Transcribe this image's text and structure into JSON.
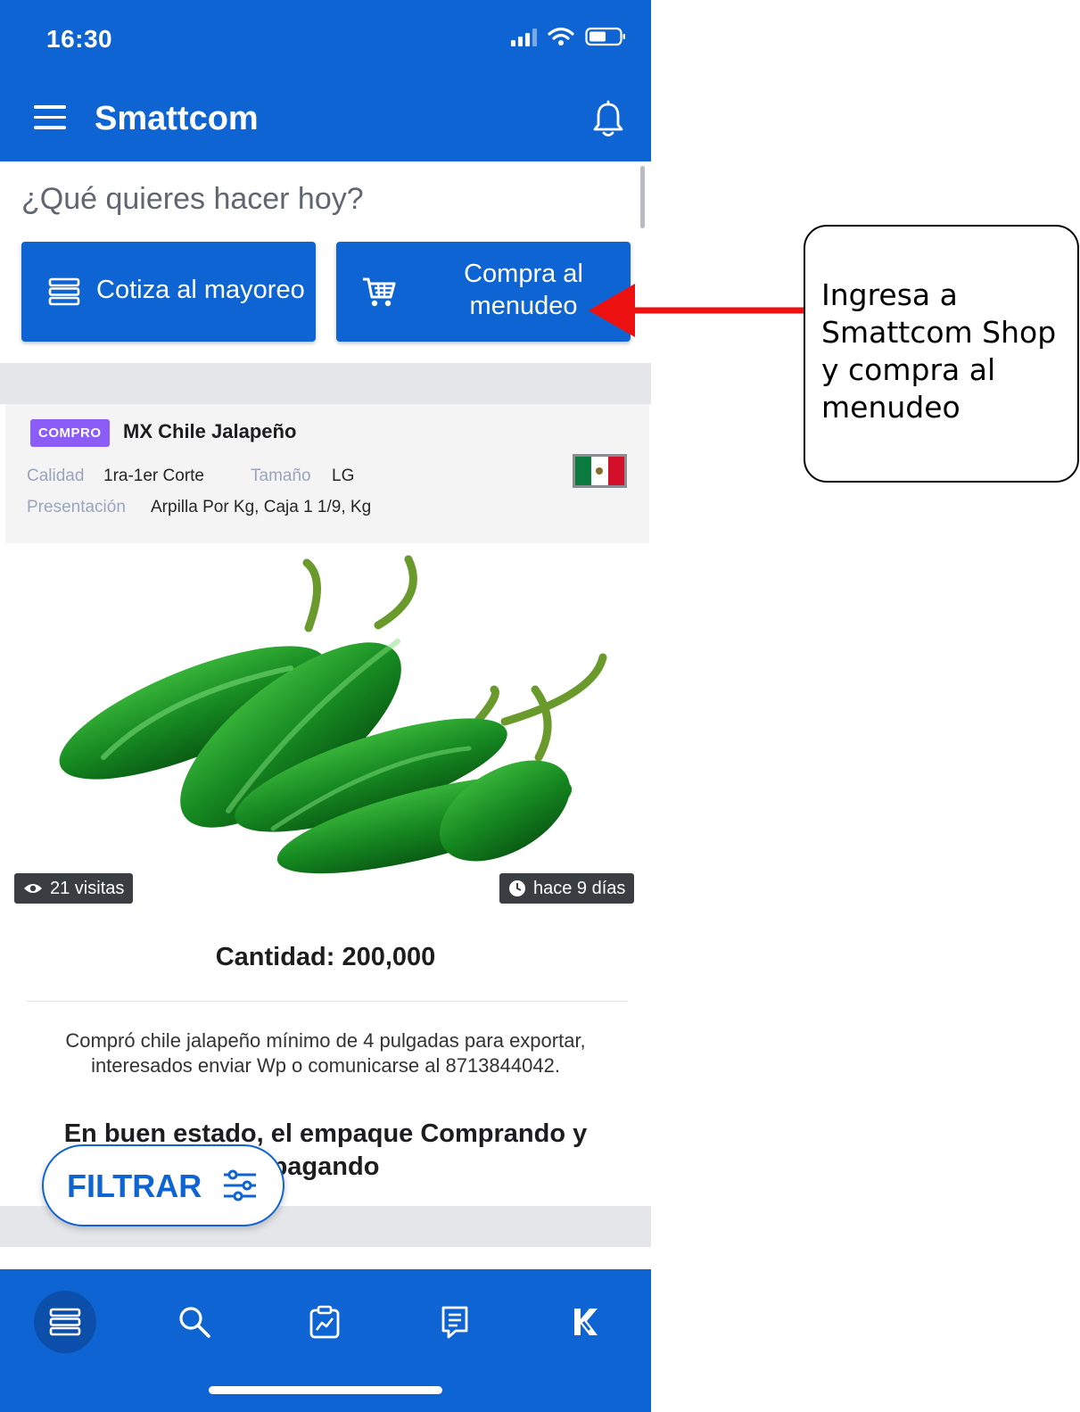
{
  "status": {
    "time": "16:30"
  },
  "appbar": {
    "title": "Smattcom"
  },
  "home": {
    "question": "¿Qué quieres hacer hoy?",
    "wholesale_label": "Cotiza al mayoreo",
    "retail_label_line1": "Compra al",
    "retail_label_line2": "menudeo"
  },
  "card": {
    "badge": "COMPRO",
    "title": "MX Chile Jalapeño",
    "quality_label": "Calidad",
    "quality_value": "1ra-1er Corte",
    "size_label": "Tamaño",
    "size_value": "LG",
    "presentation_label": "Presentación",
    "presentation_value": "Arpilla Por Kg, Caja 1 1/9, Kg",
    "views": "21 visitas",
    "age": "hace 9 días",
    "quantity": "Cantidad: 200,000",
    "description": "Compró chile jalapeño mínimo de 4 pulgadas para exportar, interesados enviar Wp o comunicarse al 8713844042.",
    "condition": "En buen estado, el empaque Comprando y pagando"
  },
  "filter": {
    "label": "FILTRAR"
  },
  "annotation": {
    "line1": "Ingresa a",
    "line2": "Smattcom Shop",
    "line3": "y compra al",
    "line4": "menudeo"
  },
  "colors": {
    "brand_blue": "#0e64d2",
    "badge_purple": "#8b5cf6",
    "arrow_red": "#ee1111"
  },
  "icons": {
    "menu": "hamburger-icon",
    "bell": "bell-icon",
    "wholesale": "stack-icon",
    "retail": "cart-icon",
    "views": "eye-icon",
    "age": "clock-icon",
    "filter": "sliders-icon",
    "nav": [
      "stack-icon",
      "search-icon",
      "analytics-icon",
      "list-icon",
      "k-logo-icon"
    ]
  }
}
